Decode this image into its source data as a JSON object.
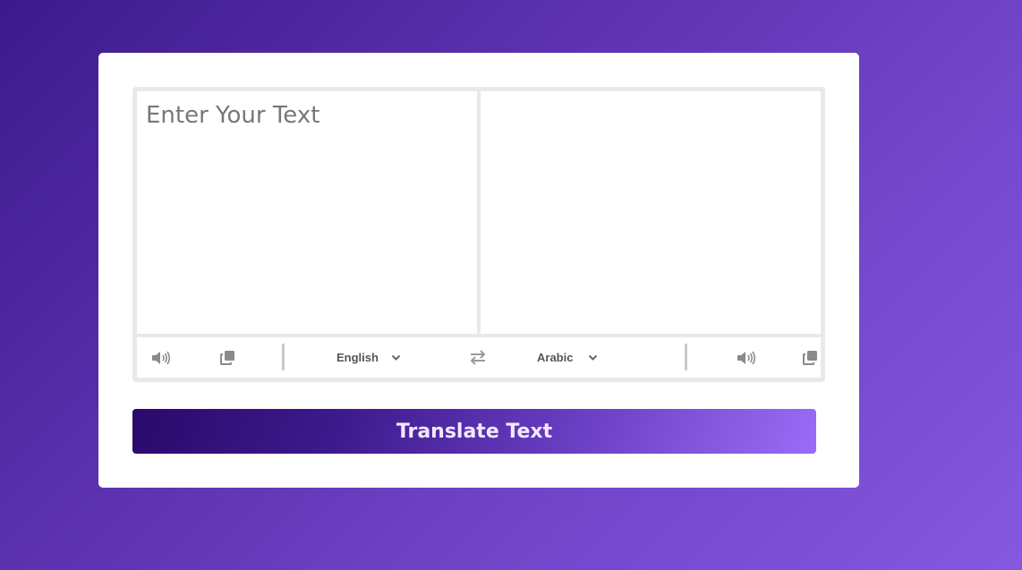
{
  "source": {
    "placeholder": "Enter Your Text",
    "value": ""
  },
  "target": {
    "value": ""
  },
  "controls": {
    "source_language": "English",
    "target_language": "Arabic",
    "icons": {
      "source_speak": "speaker-icon",
      "source_copy": "copy-icon",
      "swap": "swap-icon",
      "target_speak": "speaker-icon",
      "target_copy": "copy-icon",
      "dropdown": "chevron-down-icon"
    }
  },
  "translate_button": {
    "label": "Translate Text"
  },
  "colors": {
    "background_start": "#3c1a8c",
    "background_end": "#8458e0",
    "button_start": "#2a0a6b",
    "button_end": "#9b6cf6",
    "border": "#e9e9e9",
    "icon": "#8a8a8a"
  }
}
